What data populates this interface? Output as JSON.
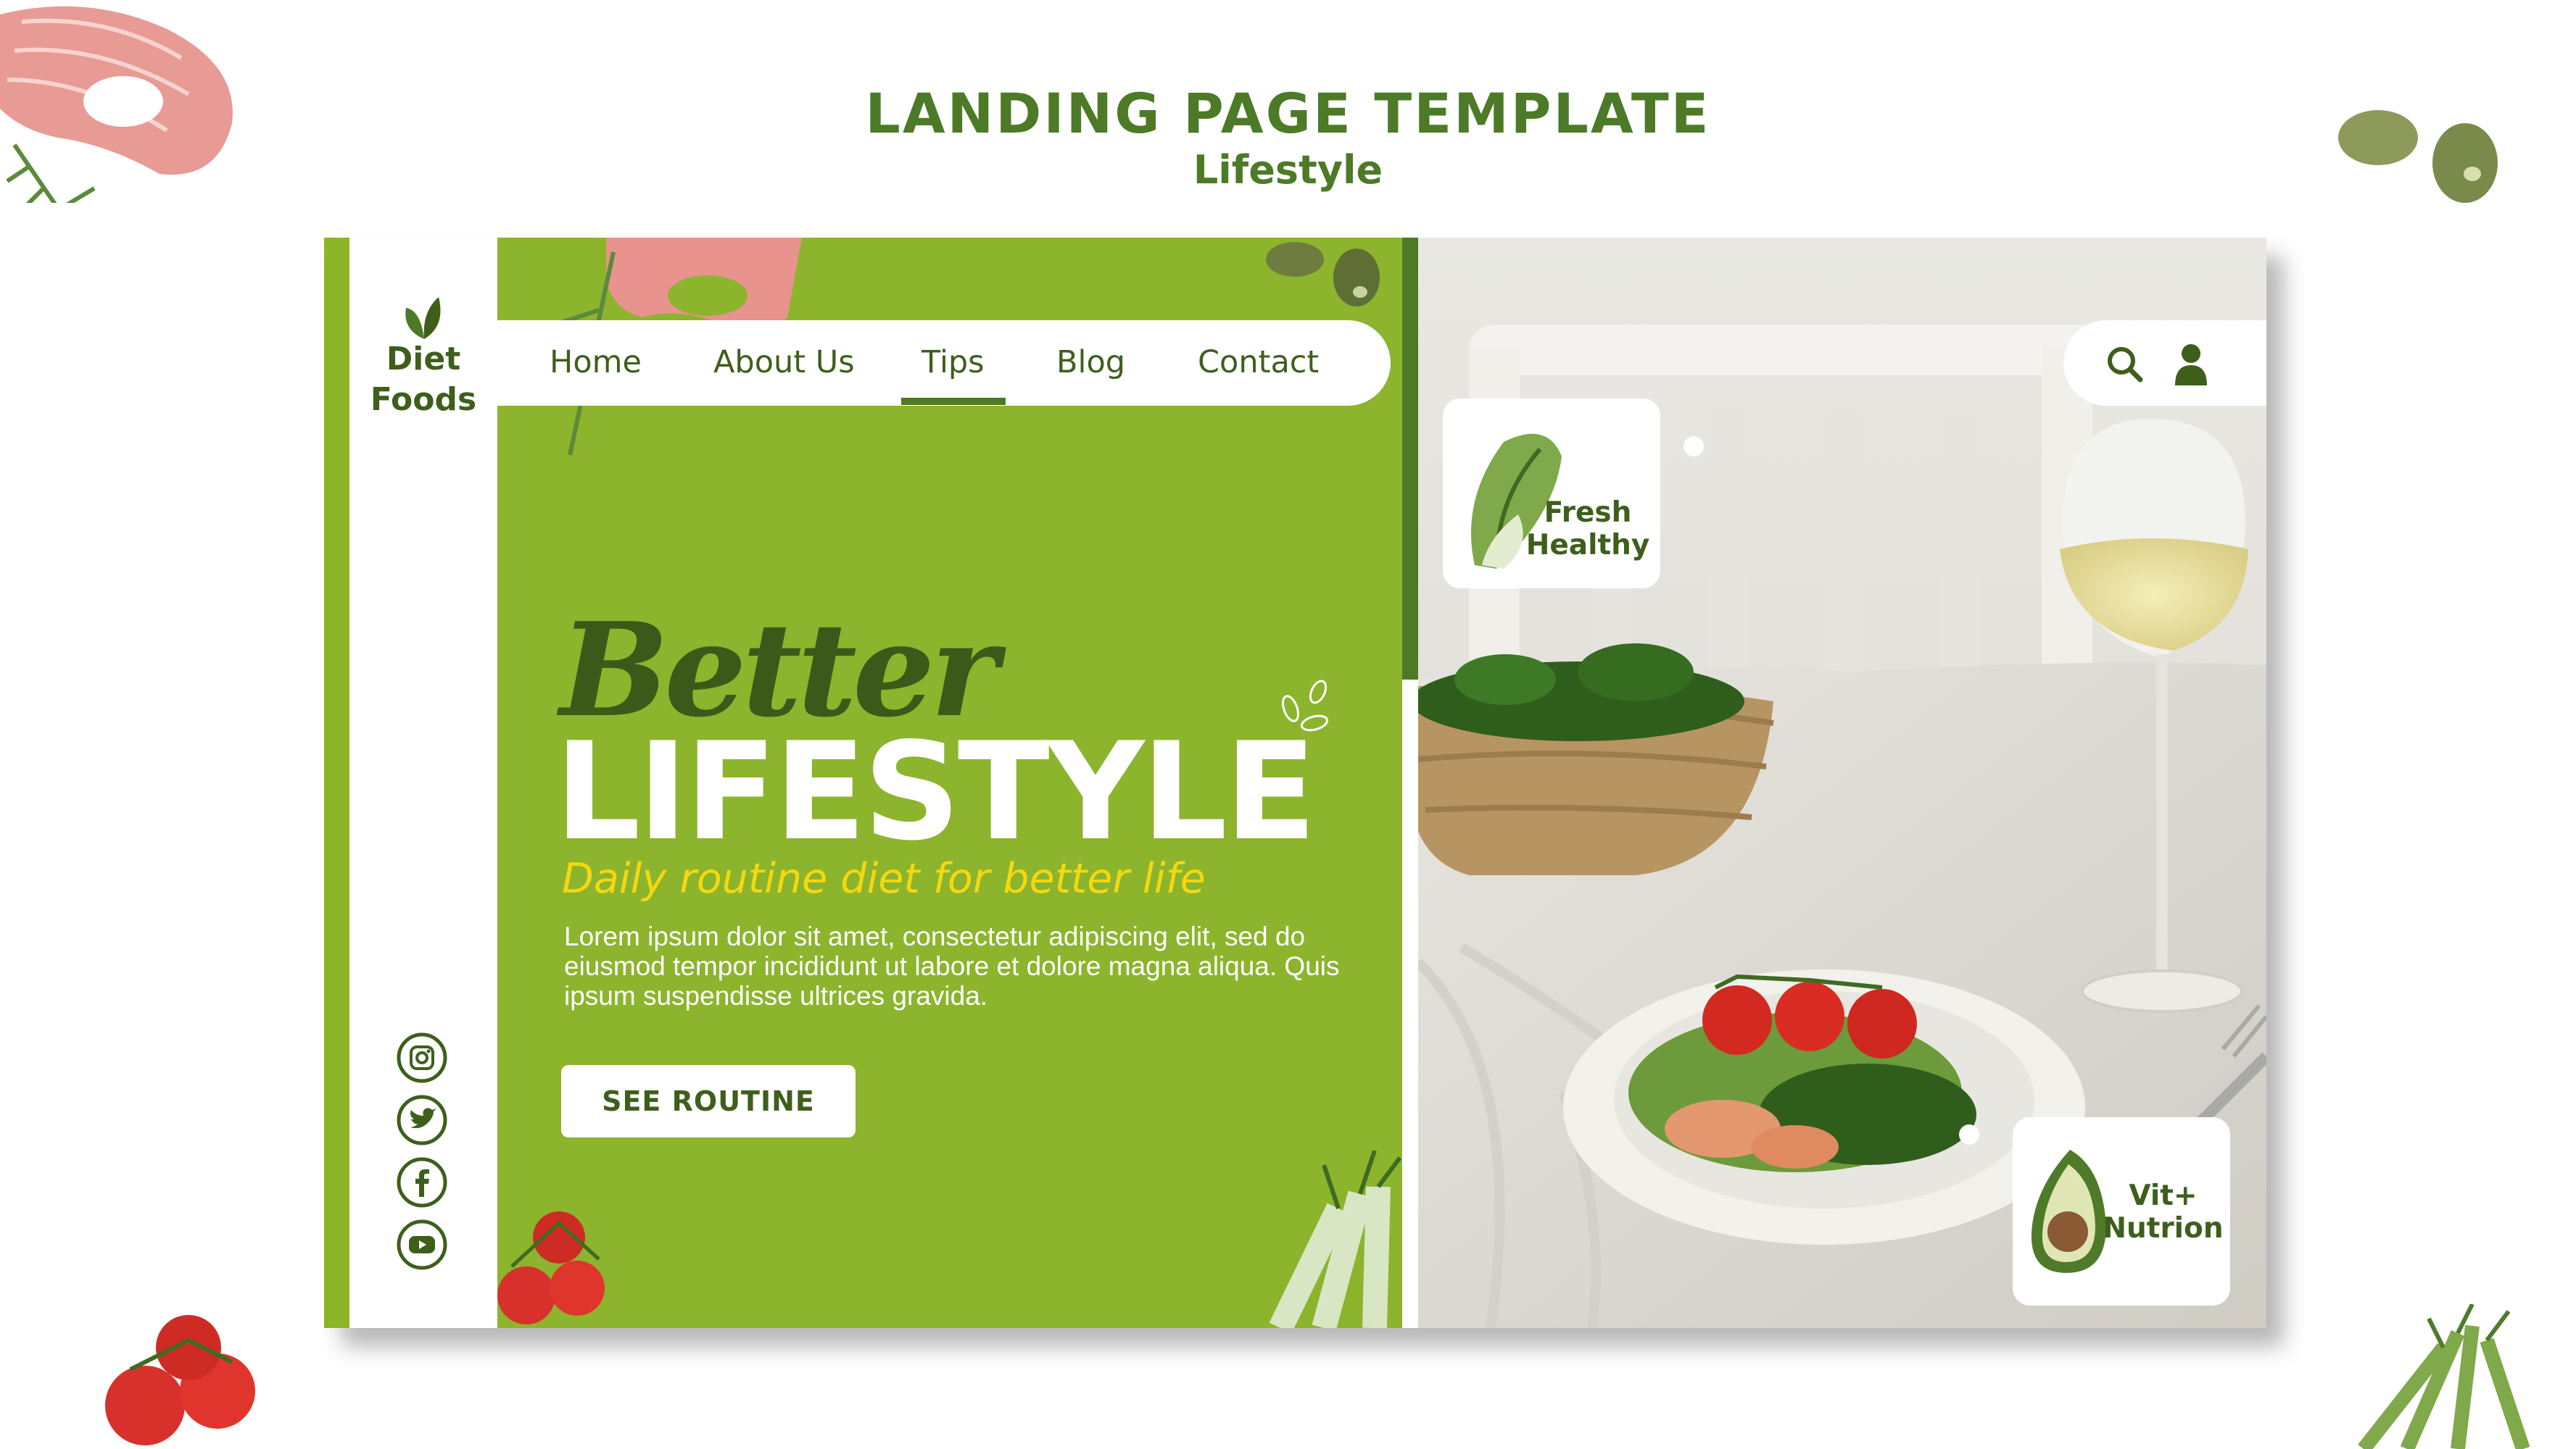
{
  "page": {
    "title": "LANDING PAGE TEMPLATE",
    "subtitle": "Lifestyle"
  },
  "brand": {
    "logo_icon": "leaf-icon",
    "name_line1": "Diet",
    "name_line2": "Foods"
  },
  "nav": {
    "items": [
      {
        "label": "Home"
      },
      {
        "label": "About Us"
      },
      {
        "label": "Tips",
        "active": true
      },
      {
        "label": "Blog"
      },
      {
        "label": "Contact"
      }
    ]
  },
  "utility": {
    "search_icon": "search-icon",
    "user_icon": "user-icon"
  },
  "hero": {
    "script_word": "Better",
    "headline": "LIFESTYLE",
    "tagline": "Daily routine diet for better life",
    "body": "Lorem ipsum dolor sit amet, consectetur adipiscing elit, sed do eiusmod tempor incididunt ut labore et dolore magna aliqua. Quis ipsum suspendisse ultrices gravida.",
    "cta_label": "SEE ROUTINE"
  },
  "badges": [
    {
      "icon": "bok-choy-icon",
      "line1": "Fresh",
      "line2": "Healthy"
    },
    {
      "icon": "avocado-icon",
      "line1": "Vit+",
      "line2": "Nutrion"
    }
  ],
  "social": [
    "instagram-icon",
    "twitter-icon",
    "facebook-icon",
    "youtube-icon"
  ],
  "colors": {
    "brand_green": "#8cb42d",
    "dark_green": "#4d7a26",
    "text_green": "#3e5f1c",
    "accent_yellow": "#f5d80f"
  }
}
